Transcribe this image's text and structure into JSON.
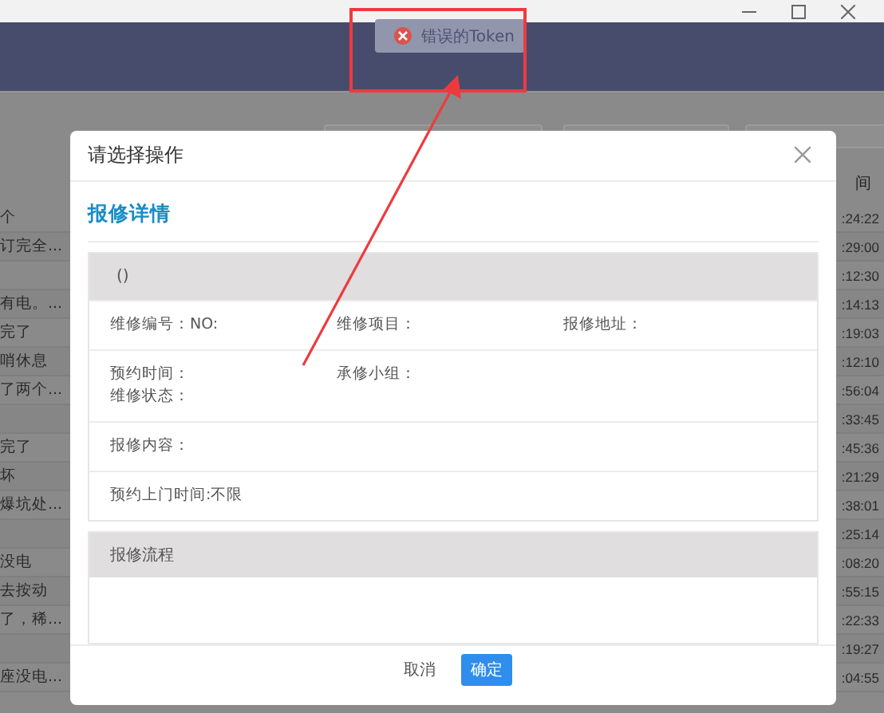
{
  "toast": {
    "kind": "error",
    "message": "错误的Token"
  },
  "background_table": {
    "header": "间",
    "rows": [
      {
        "column_1": "个",
        "column_2": ":24:22"
      },
      {
        "column_1": "订完全...",
        "column_2": ":29:00"
      },
      {
        "column_2": ":12:30"
      },
      {
        "column_1": "有电。...",
        "column_2": ":14:13"
      },
      {
        "column_1": "完了",
        "column_2": ":19:03"
      },
      {
        "column_1": "哨休息",
        "column_2": ":12:10"
      },
      {
        "column_1": "了两个...",
        "column_2": ":56:04"
      },
      {
        "column_2": ":33:45"
      },
      {
        "column_1": "完了",
        "column_2": ":45:36"
      },
      {
        "column_1": "坏",
        "column_2": ":21:29"
      },
      {
        "column_1": "爆坑处...",
        "column_2": ":38:01"
      },
      {
        "column_2": ":25:14"
      },
      {
        "column_1": "没电",
        "column_2": ":08:20"
      },
      {
        "column_1": "去按动",
        "column_2": ":55:15"
      },
      {
        "column_1": "了，稀...",
        "column_2": ":22:33"
      },
      {
        "column_2": ":19:27"
      },
      {
        "column_1": "座没电...",
        "column_2": ":04:55"
      }
    ]
  },
  "dialog": {
    "title": "请选择操作",
    "section_title": "报修详情",
    "detail_header": "()",
    "detail_rows": [
      [
        [
          "维修编号：NO:"
        ],
        [
          "维修项目："
        ],
        [
          "报修地址："
        ]
      ],
      [
        [
          "预约时间：",
          "维修状态："
        ],
        [
          "承修小组："
        ]
      ],
      [
        [
          "报修内容："
        ]
      ],
      [
        [
          "预约上门时间:不限"
        ]
      ]
    ],
    "process_title": "报修流程",
    "buttons": [
      {
        "label": "取消",
        "primary": false
      },
      {
        "label": "确定",
        "primary": true
      }
    ]
  }
}
